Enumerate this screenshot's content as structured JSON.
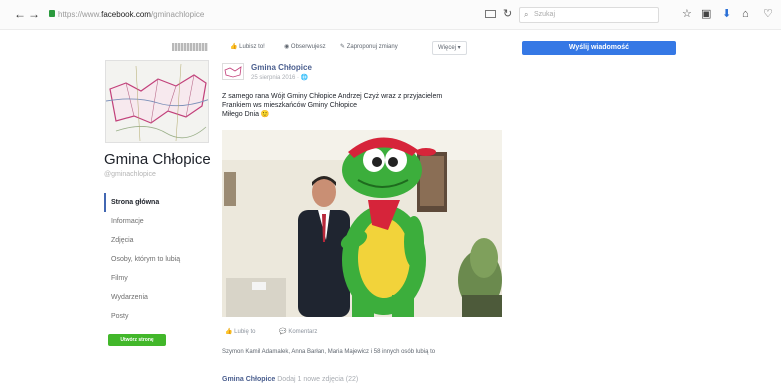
{
  "browser": {
    "url_prefix": "https://www.",
    "url_domain": "facebook.com",
    "url_path": "/gminachlopice",
    "search_placeholder": "Szukaj",
    "back_glyph": "←",
    "forward_glyph": "→",
    "reload_glyph": "↻",
    "toolbar_icons": [
      "☆",
      "▣",
      "⬇",
      "⌂",
      "♡"
    ]
  },
  "sidebar": {
    "page_name": "Gmina Chłopice",
    "handle": "@gminachlopice",
    "items": [
      {
        "label": "Strona główna",
        "active": true
      },
      {
        "label": "Informacje",
        "active": false
      },
      {
        "label": "Zdjęcia",
        "active": false
      },
      {
        "label": "Osoby, którym to lubią",
        "active": false
      },
      {
        "label": "Filmy",
        "active": false
      },
      {
        "label": "Wydarzenia",
        "active": false
      },
      {
        "label": "Posty",
        "active": false
      }
    ],
    "create_button": "Utwórz stronę"
  },
  "action_bar": {
    "like": "Lubisz to!",
    "follow": "Obserwujesz",
    "suggest": "Zaproponuj zmiany",
    "more": "Więcej ▾"
  },
  "post": {
    "author": "Gmina Chłopice",
    "meta": "25 sierpnia 2016 · ",
    "text_line1": "Z samego rana Wójt Gminy Chłopice Andrzej Czyż wraz z przyjacielem",
    "text_line2": "Frankiem ws mieszkańców Gminy Chłopice",
    "text_line3": "Miłego Dnia 🙂",
    "like_action": "Lubię to",
    "comment_action": "Komentarz",
    "likes_text": "Szymon Kamil Adamalek, Anna Barłan, Maria Majewicz i 58 innych osób lubią to"
  },
  "next_post": {
    "author": "Gmina Chłopice",
    "text": "Dodaj 1 nowe zdjęcia (22)"
  },
  "right": {
    "send_message": "Wyślij wiadomość"
  },
  "colors": {
    "accent": "#3578e5",
    "create": "#42b72a",
    "link": "#4b5f8f"
  }
}
